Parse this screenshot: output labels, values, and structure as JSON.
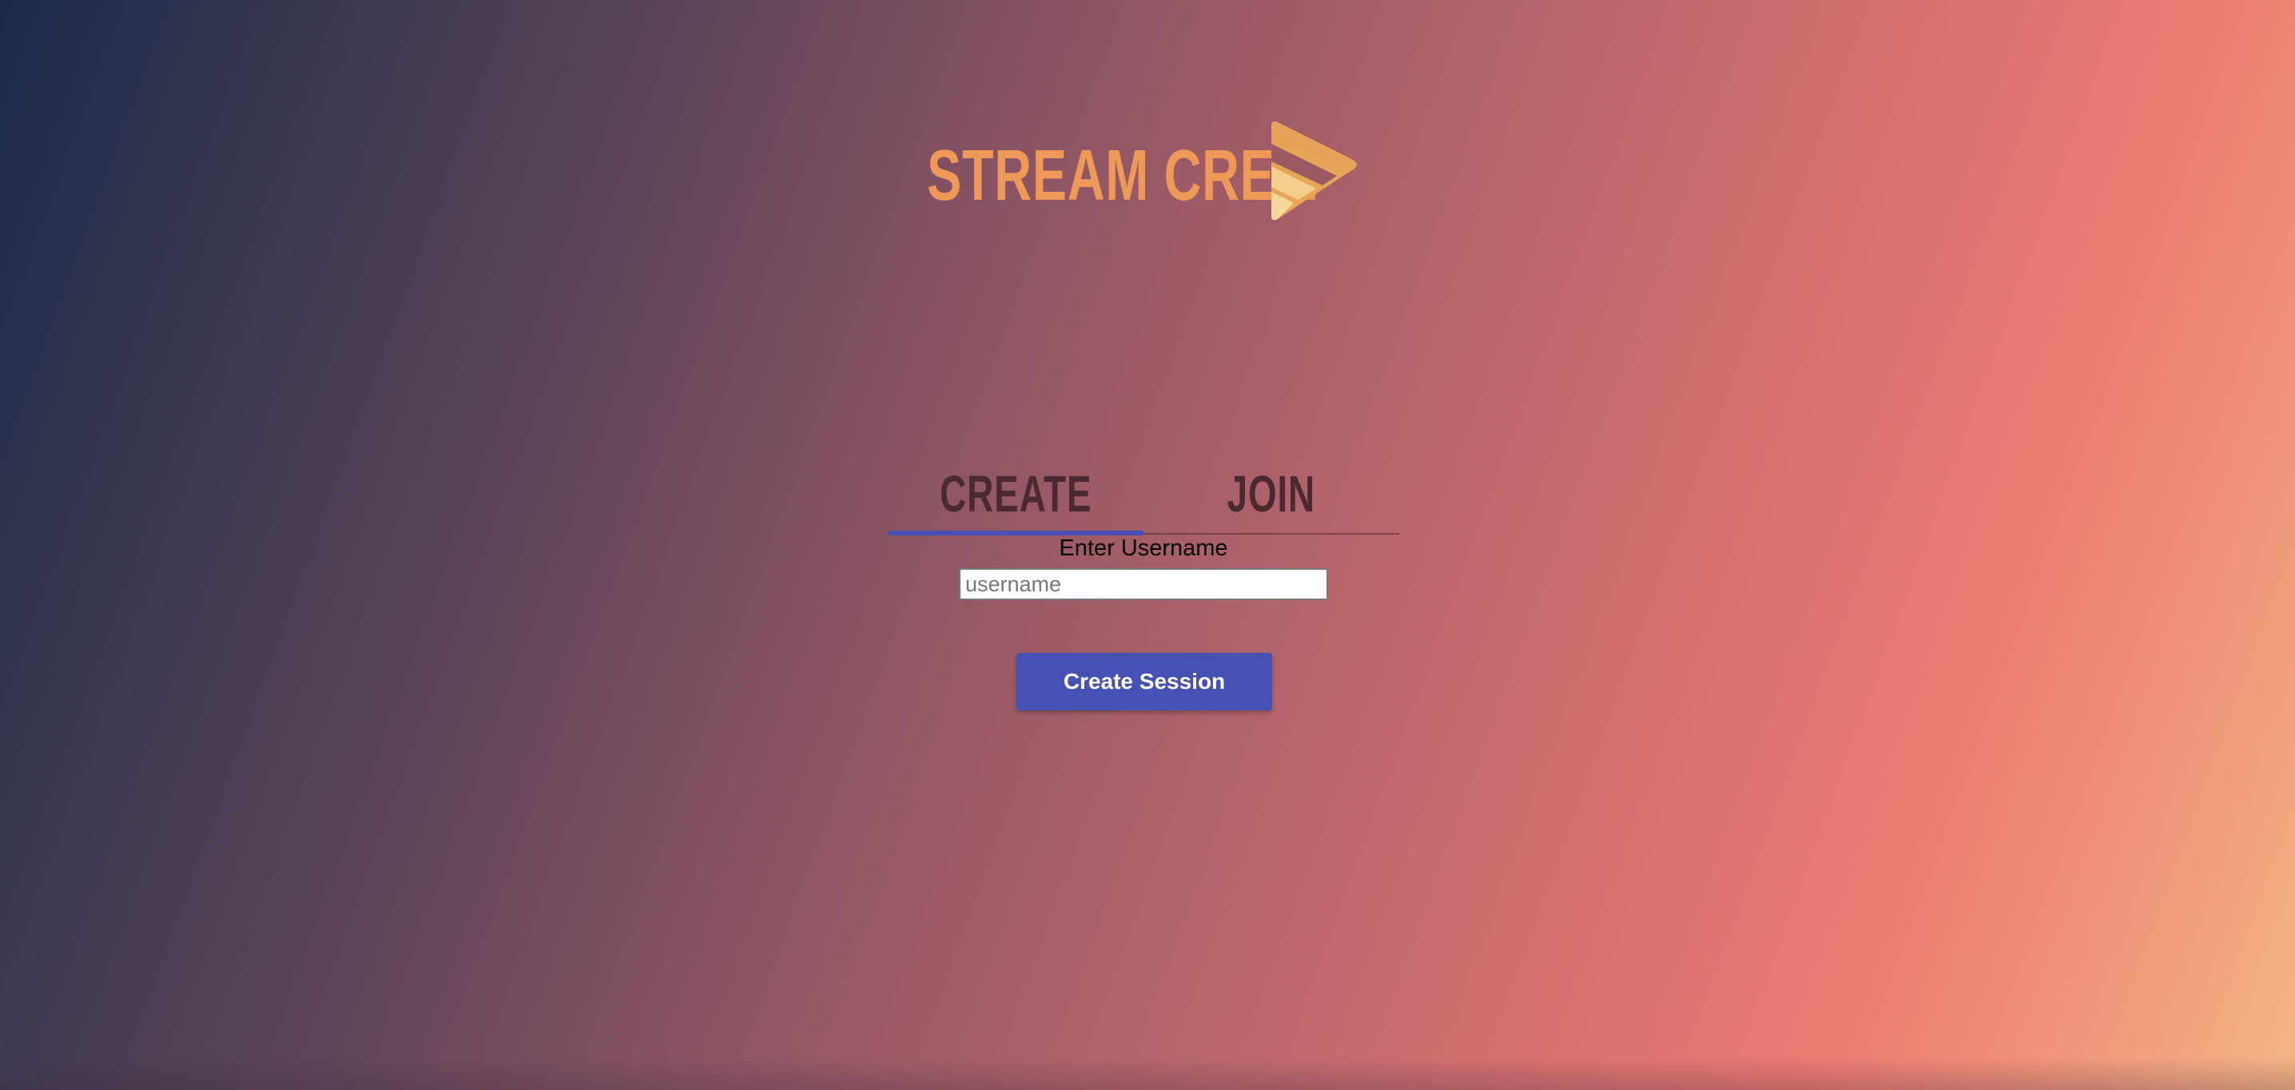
{
  "app": {
    "logo_text": "STREAM CREW",
    "logo_icon": "play-logo-icon"
  },
  "tabs": [
    {
      "label": "CREATE",
      "active": true
    },
    {
      "label": "JOIN",
      "active": false
    }
  ],
  "form": {
    "username_label": "Enter Username",
    "username_value": "",
    "username_placeholder": "username",
    "submit_label": "Create Session"
  },
  "colors": {
    "logo": "#ee9957",
    "tab_text": "#4a2a30",
    "tab_indicator": "#4a4fb5",
    "button": "#4652b3",
    "background_start": "#1b2a4a",
    "background_end": "#f3b585"
  }
}
